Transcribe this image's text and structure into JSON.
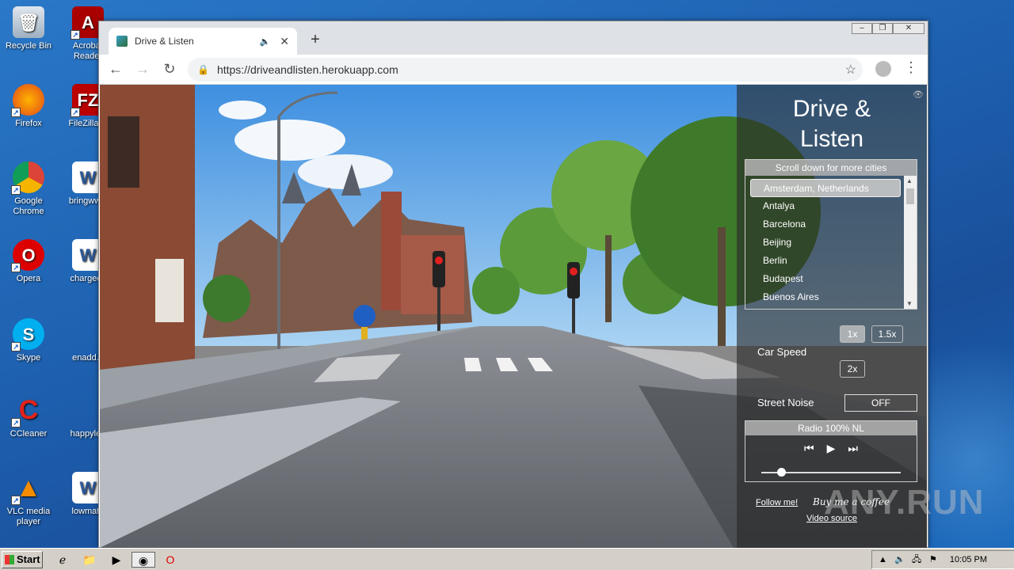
{
  "desktop": {
    "icons": [
      {
        "label": "Recycle Bin",
        "icon": "recycle-bin-icon"
      },
      {
        "label": "Acrobat Reader",
        "icon": "acrobat-icon"
      },
      {
        "label": "Firefox",
        "icon": "firefox-icon"
      },
      {
        "label": "FileZilla C",
        "icon": "filezilla-icon"
      },
      {
        "label": "Google Chrome",
        "icon": "chrome-icon"
      },
      {
        "label": "bringwww",
        "icon": "word-doc-icon"
      },
      {
        "label": "Opera",
        "icon": "opera-icon"
      },
      {
        "label": "chargecv",
        "icon": "word-doc-icon"
      },
      {
        "label": "Skype",
        "icon": "skype-icon"
      },
      {
        "label": "enadd.p",
        "icon": "file-icon"
      },
      {
        "label": "CCleaner",
        "icon": "ccleaner-icon"
      },
      {
        "label": "happylea",
        "icon": "file-icon"
      },
      {
        "label": "VLC media player",
        "icon": "vlc-icon"
      },
      {
        "label": "lowmatu",
        "icon": "word-doc-icon"
      }
    ]
  },
  "browser": {
    "tab_title": "Drive & Listen",
    "url": "https://driveandlisten.herokuapp.com",
    "new_tab": "+",
    "close_tab": "✕"
  },
  "app": {
    "title_line1": "Drive &",
    "title_line2": "Listen",
    "city_header": "Scroll down for more cities",
    "cities": [
      "Amsterdam, Netherlands",
      "Antalya",
      "Barcelona",
      "Beijing",
      "Berlin",
      "Budapest",
      "Buenos Aires"
    ],
    "selected_city": "Amsterdam, Netherlands",
    "car_speed_label": "Car Speed",
    "speeds": [
      "1x",
      "1.5x",
      "2x"
    ],
    "selected_speed": "1x",
    "street_noise_label": "Street Noise",
    "street_noise_value": "OFF",
    "radio_station": "Radio 100% NL",
    "volume": 0.14,
    "follow_link": "Follow me!",
    "coffee_link": "Buy me a coffee",
    "video_source_link": "Video source"
  },
  "watermark": "ANY.RUN",
  "taskbar": {
    "start_label": "Start",
    "clock": "10:05 PM"
  }
}
